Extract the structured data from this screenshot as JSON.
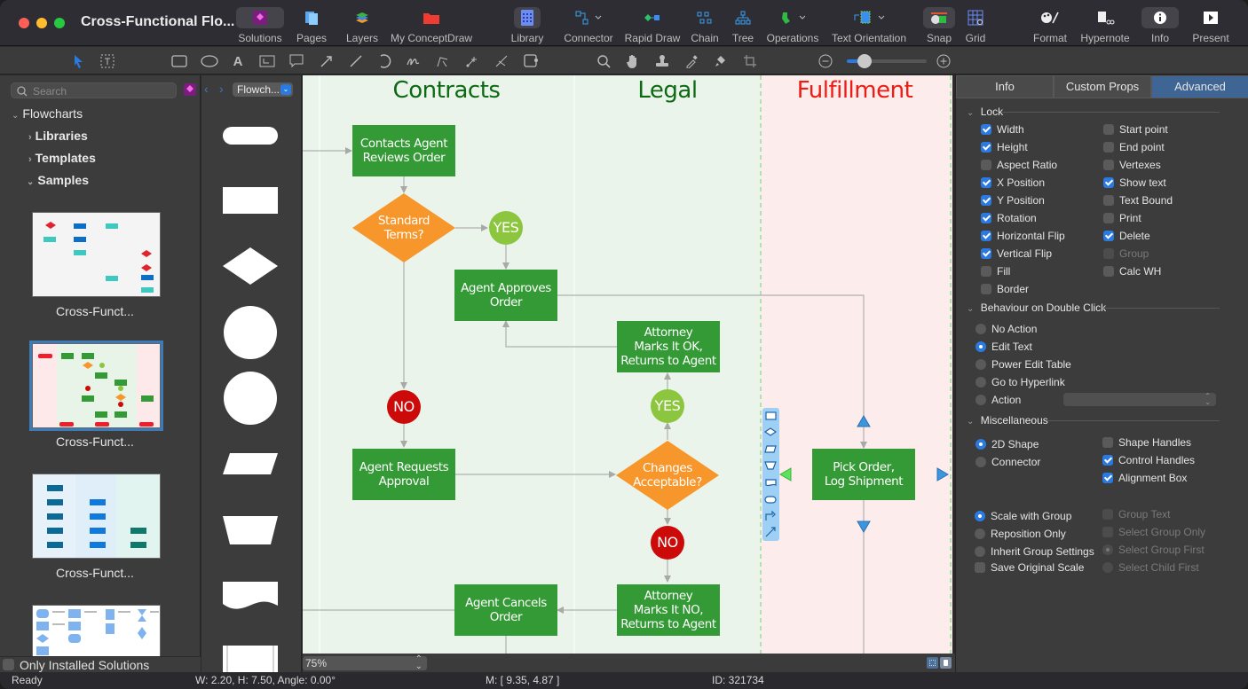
{
  "window": {
    "title": "Cross-Functional Flo..."
  },
  "toolbar": {
    "left_items": [
      {
        "label": "Solutions",
        "icon": "solutions-icon"
      },
      {
        "label": "Pages",
        "icon": "pages-icon"
      },
      {
        "label": "Layers",
        "icon": "layers-icon"
      },
      {
        "label": "My ConceptDraw",
        "icon": "folder-icon"
      }
    ],
    "center_items": [
      {
        "label": "Library",
        "icon": "library-icon"
      },
      {
        "label": "Connector",
        "icon": "connector-icon"
      },
      {
        "label": "Rapid Draw",
        "icon": "rapid-draw-icon"
      },
      {
        "label": "Chain",
        "icon": "chain-icon"
      },
      {
        "label": "Tree",
        "icon": "tree-icon"
      },
      {
        "label": "Operations",
        "icon": "operations-icon"
      },
      {
        "label": "Text Orientation",
        "icon": "text-orientation-icon"
      },
      {
        "label": "Snap",
        "icon": "snap-icon"
      },
      {
        "label": "Grid",
        "icon": "grid-icon"
      }
    ],
    "right_items": [
      {
        "label": "Format",
        "icon": "format-icon"
      },
      {
        "label": "Hypernote",
        "icon": "hypernote-icon"
      },
      {
        "label": "Info",
        "icon": "info-icon"
      },
      {
        "label": "Present",
        "icon": "present-icon"
      }
    ]
  },
  "zoom_slider": {
    "value_fraction": 0.2
  },
  "left_panel": {
    "search_placeholder": "Search",
    "tree": {
      "root": "Flowcharts",
      "children": [
        "Libraries",
        "Templates",
        "Samples"
      ]
    },
    "samples": [
      {
        "caption": "Cross-Funct...",
        "selected": false
      },
      {
        "caption": "Cross-Funct...",
        "selected": true
      },
      {
        "caption": "Cross-Funct...",
        "selected": false
      }
    ],
    "only_installed_label": "Only Installed Solutions"
  },
  "library": {
    "selector_label": "Flowch..."
  },
  "canvas": {
    "lanes": [
      {
        "title": "Contracts",
        "color": "#0e6a12"
      },
      {
        "title": "Legal",
        "color": "#0e6a12"
      },
      {
        "title": "Fulfillment",
        "color": "#ee1c12"
      }
    ],
    "nodes": {
      "contacts_agent": "Contacts Agent\nReviews Order",
      "standard_terms": "Standard\nTerms?",
      "yes1": "YES",
      "agent_approves": "Agent Approves\nOrder",
      "attorney_ok": "Attorney\nMarks It OK,\nReturns to Agent",
      "yes2": "YES",
      "no1": "NO",
      "agent_requests": "Agent Requests\nApproval",
      "changes_acceptable": "Changes\nAcceptable?",
      "no2": "NO",
      "agent_cancels": "Agent Cancels\nOrder",
      "attorney_no": "Attorney\nMarks It NO,\nReturns to Agent",
      "pick_order": "Pick Order,\nLog Shipment"
    },
    "colors": {
      "process": "#349a35",
      "decision": "#f7962a",
      "yes": "#8cc63f",
      "no": "#cc0a0a",
      "connector": "#b0b0b0"
    },
    "zoom_label": "75%"
  },
  "right_panel": {
    "tabs": [
      {
        "label": "Info",
        "selected": false
      },
      {
        "label": "Custom Props",
        "selected": false
      },
      {
        "label": "Advanced",
        "selected": true
      }
    ],
    "lock": {
      "title": "Lock",
      "left": [
        {
          "label": "Width",
          "checked": true
        },
        {
          "label": "Height",
          "checked": true
        },
        {
          "label": "Aspect Ratio",
          "checked": false
        },
        {
          "label": "X Position",
          "checked": true
        },
        {
          "label": "Y Position",
          "checked": true
        },
        {
          "label": "Rotation",
          "checked": true
        },
        {
          "label": "Horizontal Flip",
          "checked": true
        },
        {
          "label": "Vertical Flip",
          "checked": true
        },
        {
          "label": "Fill",
          "checked": false
        },
        {
          "label": "Border",
          "checked": false
        }
      ],
      "right": [
        {
          "label": "Start point",
          "checked": false
        },
        {
          "label": "End point",
          "checked": false
        },
        {
          "label": "Vertexes",
          "checked": false
        },
        {
          "label": "Show text",
          "checked": true
        },
        {
          "label": "Text Bound",
          "checked": false
        },
        {
          "label": "Print",
          "checked": false
        },
        {
          "label": "Delete",
          "checked": true
        },
        {
          "label": "Group",
          "checked": false,
          "disabled": true
        },
        {
          "label": "Calc WH",
          "checked": false
        }
      ]
    },
    "double_click": {
      "title": "Behaviour on Double Click",
      "options": [
        {
          "label": "No Action",
          "selected": false
        },
        {
          "label": "Edit Text",
          "selected": true
        },
        {
          "label": "Power Edit Table",
          "selected": false
        },
        {
          "label": "Go to Hyperlink",
          "selected": false
        },
        {
          "label": "Action",
          "selected": false
        }
      ],
      "action_value": ""
    },
    "misc": {
      "title": "Miscellaneous",
      "shape_type": [
        {
          "label": "2D Shape",
          "selected": true
        },
        {
          "label": "Connector",
          "selected": false
        }
      ],
      "handles": [
        {
          "label": "Shape Handles",
          "checked": false
        },
        {
          "label": "Control Handles",
          "checked": true
        },
        {
          "label": "Alignment Box",
          "checked": true
        }
      ],
      "group_scale": [
        {
          "label": "Scale with Group",
          "selected": true
        },
        {
          "label": "Reposition Only",
          "selected": false
        },
        {
          "label": "Inherit Group Settings",
          "selected": false
        }
      ],
      "save_original_scale": {
        "label": "Save Original Scale",
        "checked": false
      },
      "group_opts": [
        {
          "label": "Group Text",
          "type": "checkbox",
          "checked": false
        },
        {
          "label": "Select Group Only",
          "type": "checkbox",
          "checked": false
        },
        {
          "label": "Select Group First",
          "type": "radio",
          "selected": true
        },
        {
          "label": "Select Child First",
          "type": "radio",
          "selected": false
        }
      ]
    }
  },
  "status": {
    "state": "Ready",
    "dimensions": "W: 2.20,  H: 7.50,  Angle: 0.00°",
    "mouse": "M: [ 9.35, 4.87 ]",
    "id": "ID: 321734"
  }
}
